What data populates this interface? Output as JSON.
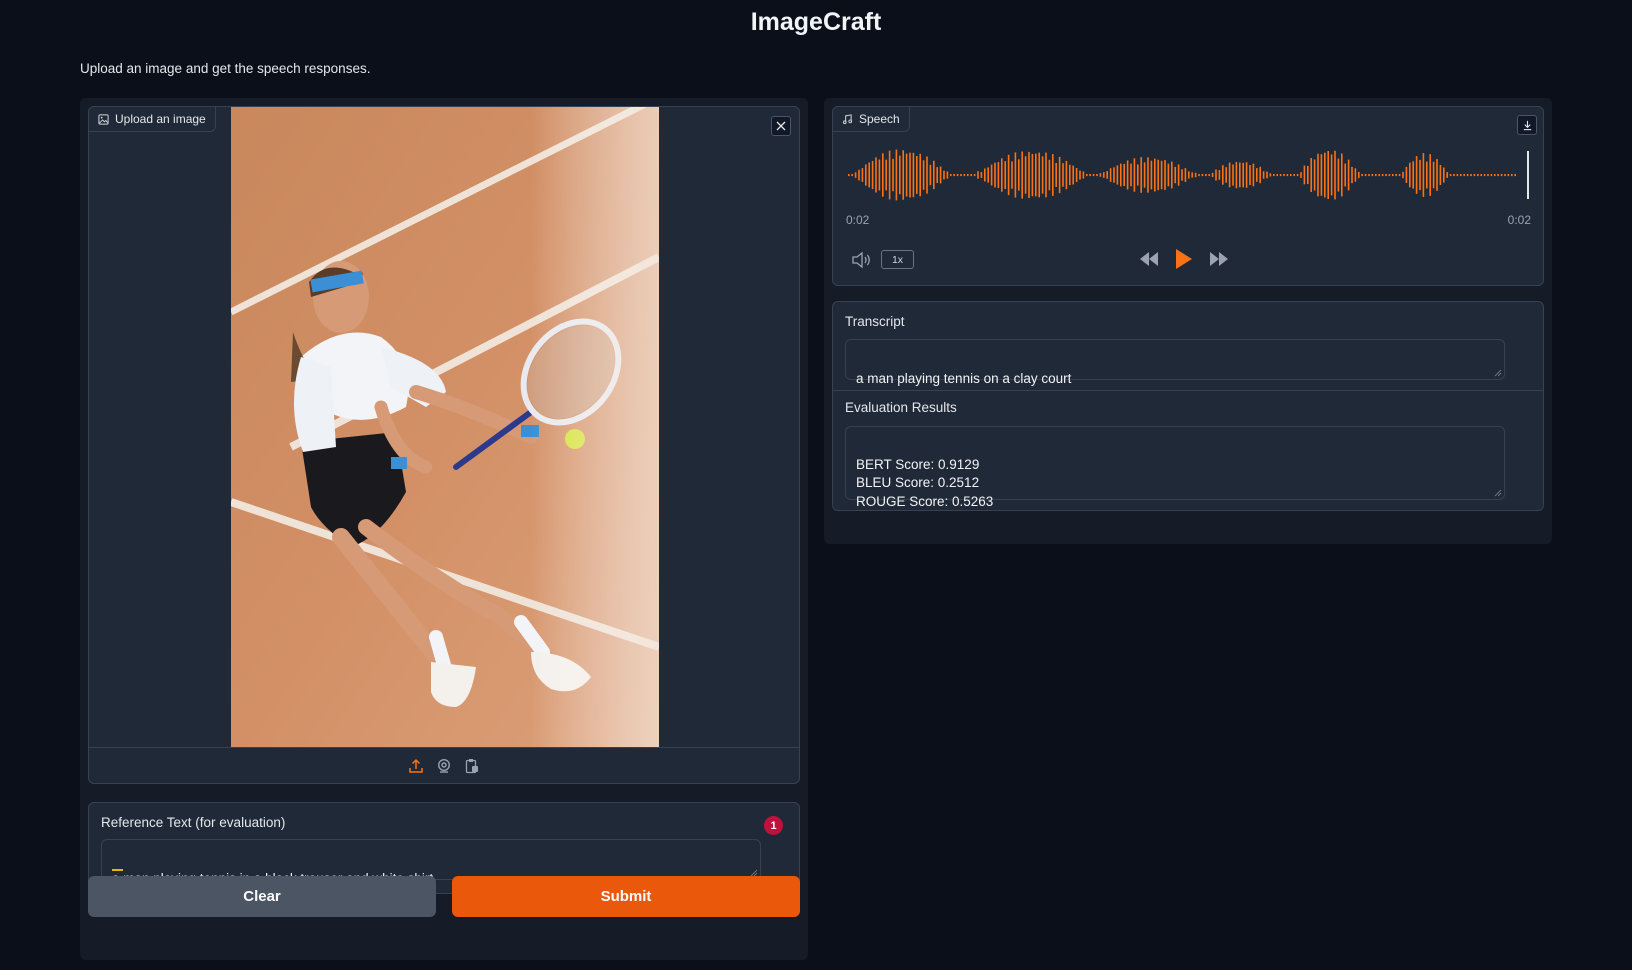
{
  "header": {
    "title": "ImageCraft",
    "description": "Upload an image and get the speech responses."
  },
  "image_input": {
    "label": "Upload an image",
    "icon": "image-icon",
    "close_icon": "close-icon",
    "sources": [
      "upload-icon",
      "webcam-icon",
      "clipboard-icon"
    ]
  },
  "reference": {
    "label": "Reference Text (for evaluation)",
    "value": "a man playing tennis in a black trouser and white shirt",
    "badge": "1"
  },
  "buttons": {
    "clear": "Clear",
    "submit": "Submit"
  },
  "speech": {
    "label": "Speech",
    "icon": "music-note-icon",
    "current_time": "0:02",
    "duration": "0:02",
    "speed": "1x",
    "progress": 1.0
  },
  "transcript": {
    "label": "Transcript",
    "value": "a man playing tennis on a clay court"
  },
  "evaluation": {
    "label": "Evaluation Results",
    "value": "BERT Score: 0.9129\nBLEU Score: 0.2512\nROUGE Score: 0.5263"
  },
  "colors": {
    "accent": "#ea580c",
    "waveform": "#f97316",
    "background": "#0b0f19",
    "panel": "#1f2937"
  }
}
